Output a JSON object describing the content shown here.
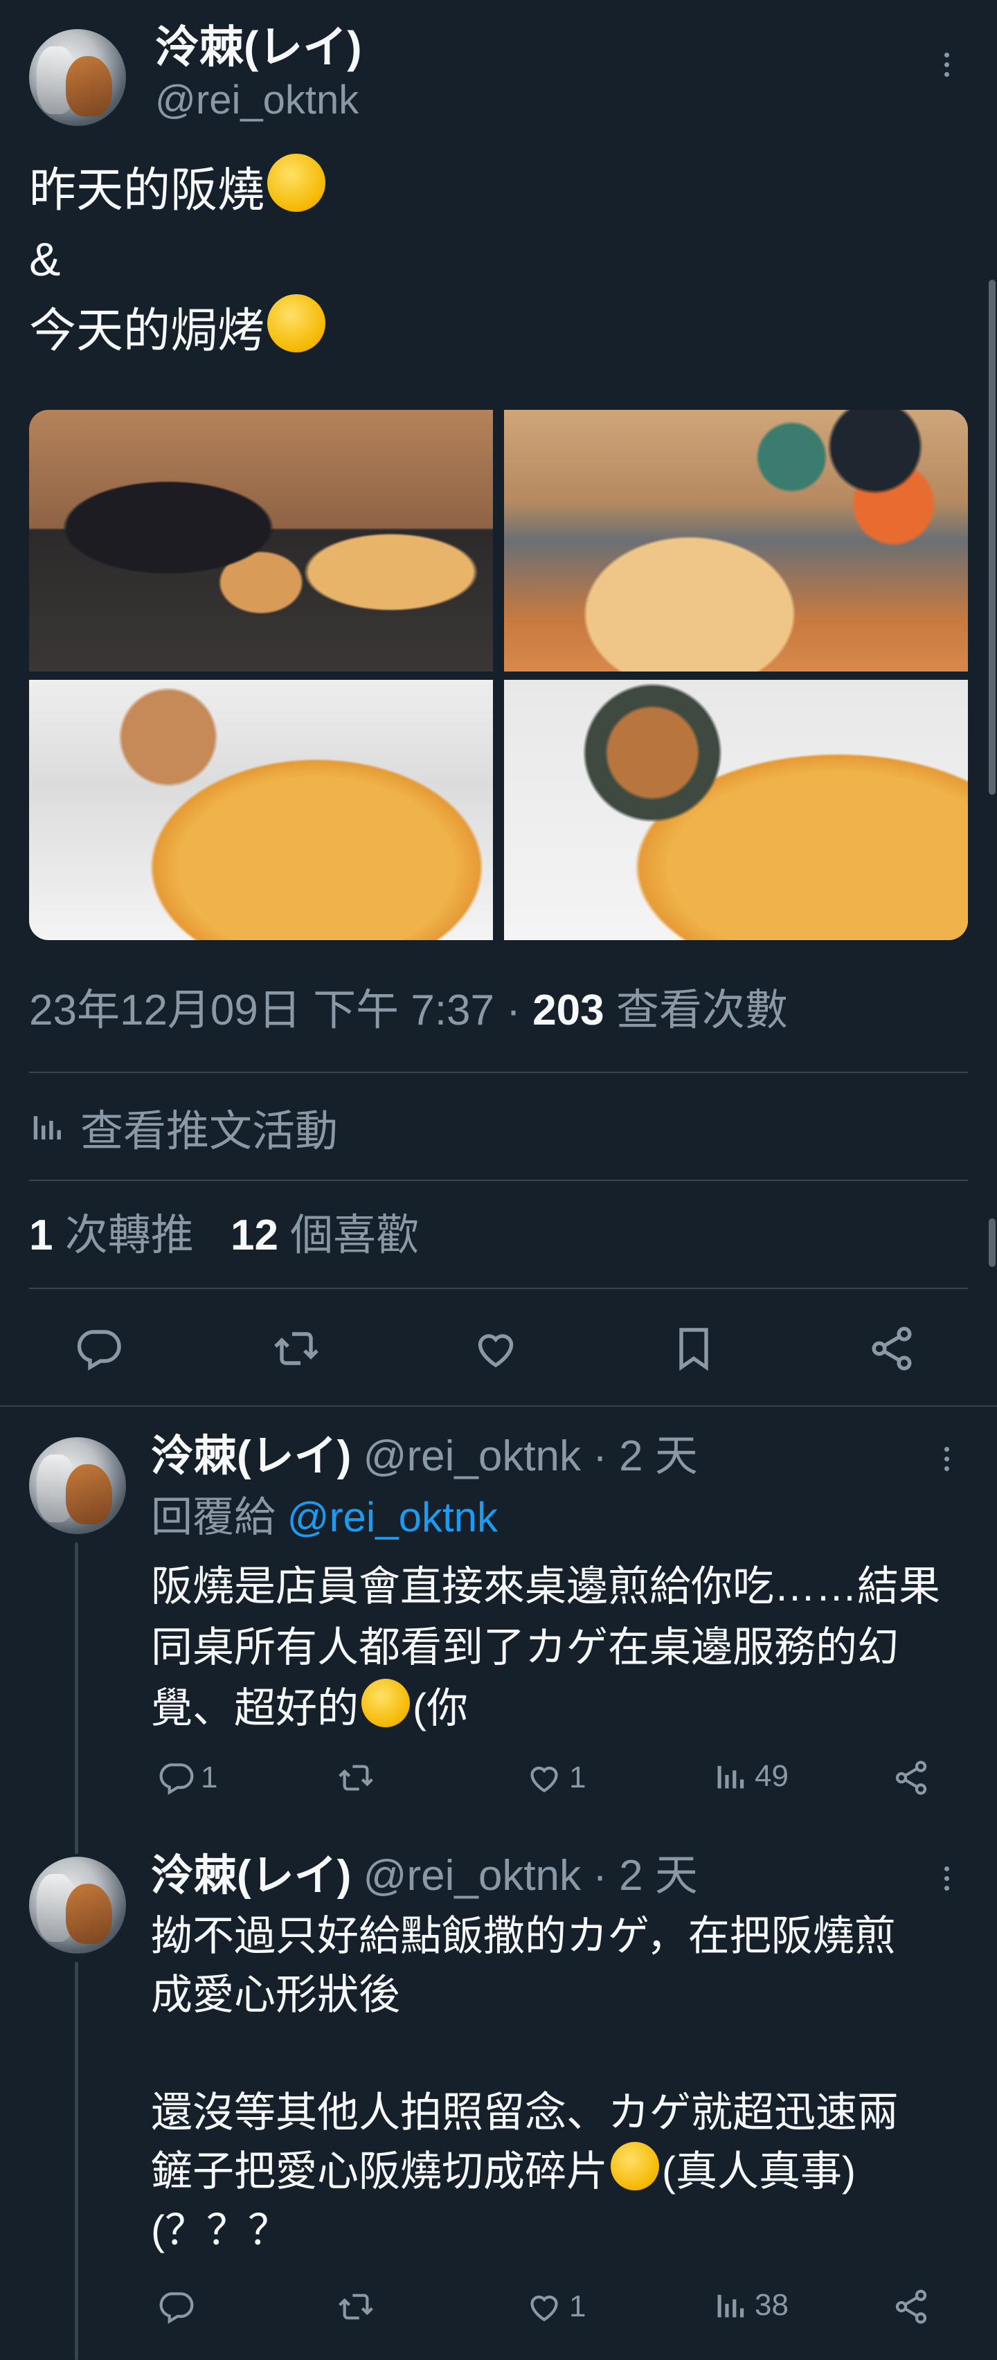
{
  "tweet": {
    "author_name": "泠棘(レイ)",
    "author_handle": "@rei_oktnk",
    "lines": [
      "昨天的阪燒",
      "&",
      "今天的焗烤"
    ],
    "photo_alts": [
      "plush-with-okonomiyaki",
      "plushies-at-grill",
      "plush-with-gratin-1",
      "plush-with-gratin-2"
    ],
    "timestamp": "23年12月09日 下午 7:37",
    "views_count": "203",
    "views_label": "查看次數",
    "activity_label": "查看推文活動",
    "retweets_count": "1",
    "retweets_label": "次轉推",
    "likes_count": "12",
    "likes_label": "個喜歡"
  },
  "actions": {
    "icons": [
      "reply-icon",
      "retweet-icon",
      "like-icon",
      "bookmark-icon",
      "share-icon"
    ]
  },
  "replies": [
    {
      "author_name": "泠棘(レイ)",
      "author_handle": "@rei_oktnk",
      "time": "· 2 天",
      "reply_to_label": "回覆給",
      "reply_to_handle": "@rei_oktnk",
      "lines": [
        "阪燒是店員會直接來桌邊煎給你吃……結果",
        "同桌所有人都看到了カゲ在桌邊服務的幻",
        "覺、超好的",
        "(你"
      ],
      "reply_count": "1",
      "retweet_count": "",
      "like_count": "1",
      "view_count": "49"
    },
    {
      "author_name": "泠棘(レイ)",
      "author_handle": "@rei_oktnk",
      "time": "· 2 天",
      "lines": [
        "拗不過只好給點飯撒的カゲ，在把阪燒煎",
        "成愛心形狀後",
        "",
        "還沒等其他人拍照留念、カゲ就超迅速兩",
        "鏟子把愛心阪燒切成碎片",
        "(真人真事)",
        "(？？？"
      ],
      "reply_count": "",
      "retweet_count": "",
      "like_count": "1",
      "view_count": "38"
    }
  ],
  "colors": {
    "background": "#15202b",
    "text": "#f7f9f9",
    "muted": "#8b98a5",
    "link": "#1d9bf0",
    "divider": "#38444d"
  }
}
